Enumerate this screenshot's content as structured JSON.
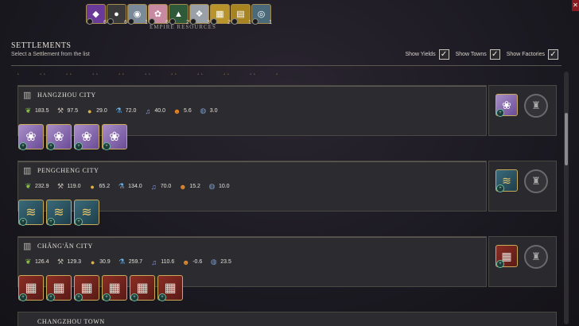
{
  "resource_bar": {
    "title": "EMPIRE RESOURCES",
    "items": [
      {
        "icon": "purple-resource-icon",
        "glyph": "◆",
        "count": "6",
        "color": "#6a3a9a"
      },
      {
        "icon": "dark-resource-icon",
        "glyph": "●",
        "count": "6",
        "color": "#3a3a3a"
      },
      {
        "icon": "silver-resource-icon",
        "glyph": "◉",
        "count": "1",
        "color": "#7a8a98"
      },
      {
        "icon": "pink-resource-icon",
        "glyph": "✿",
        "count": "6",
        "color": "#c88aa0"
      },
      {
        "icon": "green-resource-icon",
        "glyph": "▲",
        "count": "2",
        "color": "#2e5a3a"
      },
      {
        "icon": "white-resource-icon",
        "glyph": "❖",
        "count": "3",
        "color": "#9aa0a8"
      },
      {
        "icon": "gold-resource-icon",
        "glyph": "▦",
        "count": "2",
        "color": "#b8942a"
      },
      {
        "icon": "gold-bar-resource-icon",
        "glyph": "▤",
        "count": "1",
        "color": "#a88420"
      },
      {
        "icon": "blue-resource-icon",
        "glyph": "◎",
        "count": "1",
        "color": "#4a6a7a"
      }
    ]
  },
  "header": {
    "title": "SETTLEMENTS",
    "subtitle": "Select a Settlement from the list"
  },
  "toggles": [
    {
      "label": "Show Yields",
      "checked": true
    },
    {
      "label": "Show Towns",
      "checked": true
    },
    {
      "label": "Show Factories",
      "checked": true
    }
  ],
  "settlements": [
    {
      "name": "HANGZHOU CITY",
      "yields": {
        "food": "183.5",
        "production": "97.5",
        "gold": "29.0",
        "science": "72.0",
        "culture": "40.0",
        "happiness": "5.6",
        "influence": "3.0"
      },
      "resources": [
        "cotton",
        "cotton",
        "cotton",
        "cotton"
      ],
      "side_resource": "cotton"
    },
    {
      "name": "PENGCHENG CITY",
      "yields": {
        "food": "232.9",
        "production": "119.0",
        "gold": "65.2",
        "science": "134.0",
        "culture": "70.0",
        "happiness": "15.2",
        "influence": "10.0"
      },
      "resources": [
        "fish",
        "fish",
        "fish"
      ],
      "side_resource": "fish"
    },
    {
      "name": "CHĀNG'ĀN CITY",
      "yields": {
        "food": "126.4",
        "production": "129.3",
        "gold": "30.9",
        "science": "259.7",
        "culture": "110.6",
        "happiness": "-0.6",
        "influence": "23.5"
      },
      "resources": [
        "spice",
        "spice",
        "spice",
        "spice",
        "spice",
        "spice"
      ],
      "side_resource": "spice"
    }
  ],
  "next_settlement": {
    "name": "CHANGZHOU TOWN"
  },
  "glyphs": {
    "cotton": "❀",
    "fish": "≋",
    "spice": "▦",
    "city": "▥",
    "factory": "♜",
    "check": "✓",
    "close": "✕",
    "badge": "+",
    "food": "❦",
    "production": "⚒",
    "gold": "●",
    "science": "⚗",
    "culture": "♫",
    "happiness": "☻",
    "influence": "◍"
  }
}
